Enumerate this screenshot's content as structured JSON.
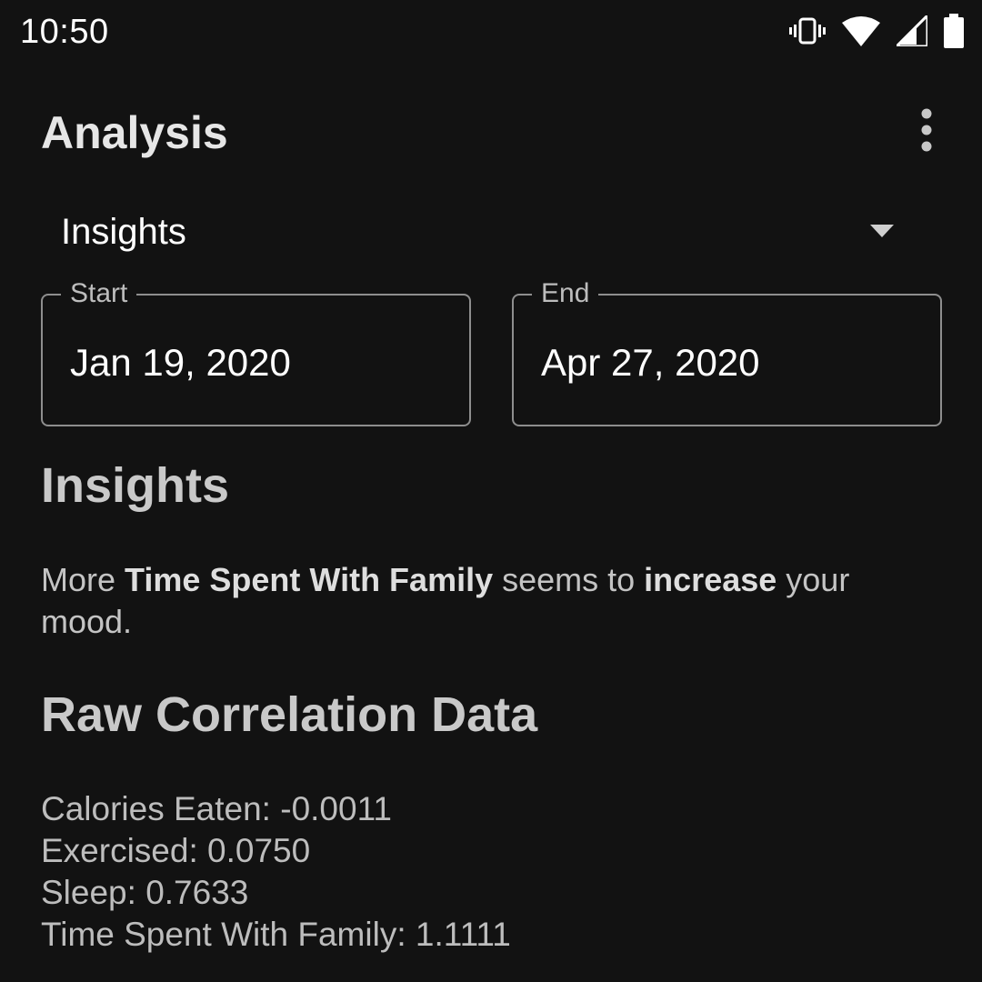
{
  "status_bar": {
    "time": "10:50",
    "icons": [
      "vibrate-icon",
      "wifi-icon",
      "signal-icon",
      "battery-icon"
    ]
  },
  "app_bar": {
    "title": "Analysis",
    "menu_icon": "more-vert-icon"
  },
  "dropdown": {
    "selected": "Insights",
    "icon": "arrow-drop-down-icon"
  },
  "date_range": {
    "start_label": "Start",
    "start_value": "Jan 19, 2020",
    "end_label": "End",
    "end_value": "Apr 27, 2020"
  },
  "insights": {
    "title": "Insights",
    "sentence": {
      "part1": "More ",
      "factor": "Time Spent With Family",
      "part2": " seems to ",
      "effect": "increase",
      "part3": " your mood."
    }
  },
  "raw_correlation": {
    "title": "Raw Correlation Data",
    "rows": [
      {
        "text": "Calories Eaten: -0.0011"
      },
      {
        "text": "Exercised: 0.0750"
      },
      {
        "text": "Sleep: 0.7633"
      },
      {
        "text": "Time Spent With Family: 1.1111"
      }
    ]
  },
  "colors": {
    "background": "#121212",
    "outline": "#8e8e8e",
    "heading": "#c9c9c9"
  }
}
